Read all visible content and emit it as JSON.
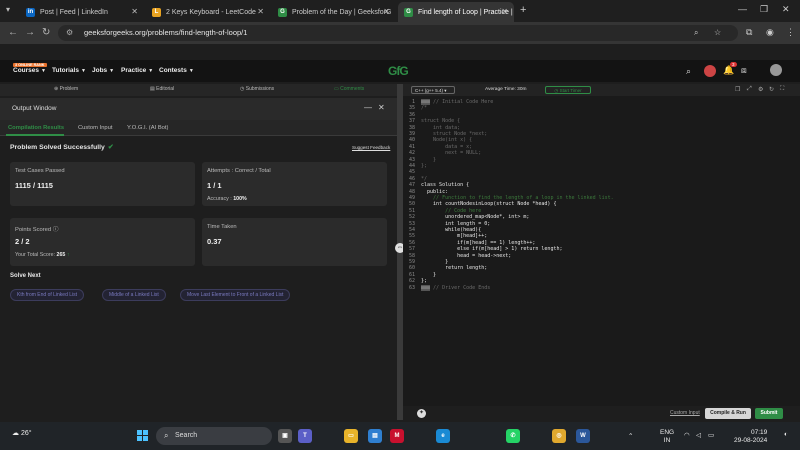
{
  "browser": {
    "tabs": [
      {
        "label": "Post | Feed | LinkedIn",
        "favicon": "in",
        "color": "#0a66c2"
      },
      {
        "label": "2 Keys Keyboard - LeetCode",
        "favicon": "L",
        "color": "#e8a321"
      },
      {
        "label": "Problem of the Day | GeeksforG",
        "favicon": "G",
        "color": "#2f8d46"
      },
      {
        "label": "Find length of Loop | Practice |",
        "favicon": "G",
        "color": "#2f8d46"
      }
    ],
    "url": "geeksforgeeks.org/problems/find-length-of-loop/1"
  },
  "site": {
    "new_badge": "3 ONLINE RANK",
    "nav": [
      "Courses",
      "Tutorials",
      "Jobs",
      "Practice",
      "Contests"
    ],
    "logo": "GfG",
    "notification_count": "3"
  },
  "problem_tabs": [
    "Problem",
    "Editorial",
    "Submissions",
    "Comments"
  ],
  "output": {
    "title": "Output Window",
    "tabs": [
      "Compilation Results",
      "Custom Input",
      "Y.O.G.I. (AI Bot)"
    ],
    "status": "Problem Solved Successfully",
    "feedback": "Suggest Feedback",
    "test_cases_label": "Test Cases Passed",
    "test_cases_value": "1115 / 1115",
    "attempts_label": "Attempts : Correct / Total",
    "attempts_value": "1 / 1",
    "accuracy_label": "Accuracy :",
    "accuracy_value": "100%",
    "points_label": "Points Scored",
    "points_value": "2 / 2",
    "total_score_label": "Your Total Score:",
    "total_score_value": "265",
    "time_label": "Time Taken",
    "time_value": "0.37",
    "solve_next_title": "Solve Next",
    "solve_next": [
      "Kth from End of Linked List",
      "Middle of a Linked List",
      "Move Last Element to Front of a Linked List"
    ]
  },
  "editor": {
    "language": "C++ (g++ 5.4)",
    "avg_time": "Average Time: 30m",
    "start_timer": "Start Timer",
    "lines": [
      {
        "n": "1",
        "t": "// Initial Code Here",
        "k": "hl"
      },
      {
        "n": "35",
        "t": "/*",
        "k": "dim"
      },
      {
        "n": "36",
        "t": "",
        "k": "dim"
      },
      {
        "n": "37",
        "t": "struct Node {",
        "k": "dim"
      },
      {
        "n": "38",
        "t": "    int data;",
        "k": "dim"
      },
      {
        "n": "39",
        "t": "    struct Node *next;",
        "k": "dim"
      },
      {
        "n": "40",
        "t": "    Node(int x) {",
        "k": "dim"
      },
      {
        "n": "41",
        "t": "        data = x;",
        "k": "dim"
      },
      {
        "n": "42",
        "t": "        next = NULL;",
        "k": "dim"
      },
      {
        "n": "43",
        "t": "    }",
        "k": "dim"
      },
      {
        "n": "44",
        "t": "};",
        "k": "dim"
      },
      {
        "n": "45",
        "t": "",
        "k": "dim"
      },
      {
        "n": "46",
        "t": "*/",
        "k": "dim"
      },
      {
        "n": "47",
        "t": "class Solution {",
        "k": ""
      },
      {
        "n": "48",
        "t": "  public:",
        "k": ""
      },
      {
        "n": "49",
        "t": "    // Function to find the length of a loop in the linked list.",
        "k": "cmt"
      },
      {
        "n": "50",
        "t": "    int countNodesinLoop(struct Node *head) {",
        "k": ""
      },
      {
        "n": "51",
        "t": "        // Code here",
        "k": "cmt"
      },
      {
        "n": "52",
        "t": "        unordered_map<Node*, int> m;",
        "k": ""
      },
      {
        "n": "53",
        "t": "        int length = 0;",
        "k": ""
      },
      {
        "n": "54",
        "t": "        while(head){",
        "k": ""
      },
      {
        "n": "55",
        "t": "            m[head]++;",
        "k": ""
      },
      {
        "n": "56",
        "t": "            if(m[head] == 1) length++;",
        "k": ""
      },
      {
        "n": "57",
        "t": "            else if(m[head] > 1) return length;",
        "k": ""
      },
      {
        "n": "58",
        "t": "            head = head->next;",
        "k": ""
      },
      {
        "n": "59",
        "t": "        }",
        "k": ""
      },
      {
        "n": "60",
        "t": "        return length;",
        "k": ""
      },
      {
        "n": "61",
        "t": "    }",
        "k": ""
      },
      {
        "n": "62",
        "t": "};",
        "k": ""
      },
      {
        "n": "63",
        "t": "// Driver Code Ends",
        "k": "hl"
      }
    ],
    "custom_input": "Custom Input",
    "compile_run": "Compile & Run",
    "submit": "Submit"
  },
  "taskbar": {
    "weather": "26°",
    "search": "Search",
    "lang": "ENG",
    "region": "IN",
    "time": "07:19",
    "date": "29-08-2024"
  }
}
